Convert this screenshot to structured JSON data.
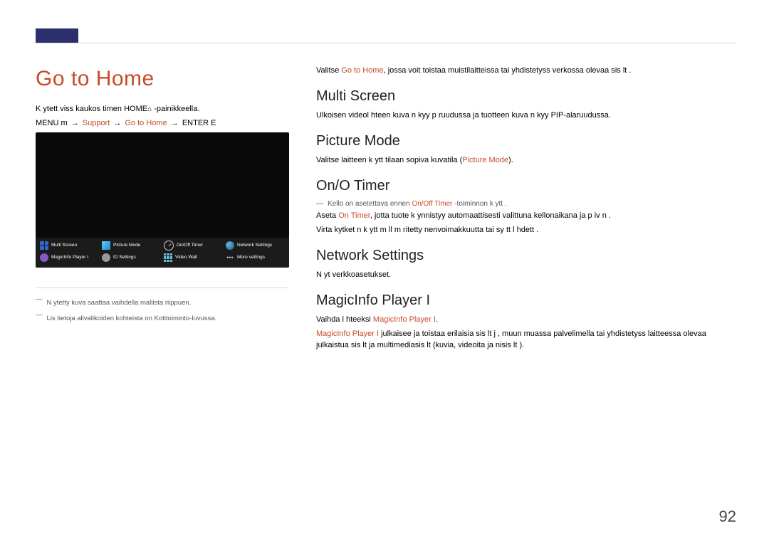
{
  "page_number": "92",
  "left": {
    "title": "Go to Home",
    "intro_a": "K ytett viss  kaukos  timen HOME",
    "intro_b": " -painikkeella.",
    "menu": {
      "menu_label": "MENU m",
      "support": "Support",
      "gotohome": "Go to Home",
      "enter": "ENTER E"
    },
    "screenshot_items": [
      {
        "label": "Multi Screen"
      },
      {
        "label": "Picture Mode"
      },
      {
        "label": "On/Off Timer"
      },
      {
        "label": "Network Settings"
      },
      {
        "label": "MagicInfo Player I"
      },
      {
        "label": "ID Settings"
      },
      {
        "label": "Video Wall"
      },
      {
        "label": "More settings"
      }
    ],
    "footnote1": "N ytetty kuva saattaa vaihdella mallista riippuen.",
    "footnote2": "Lis tietoja alivalikoiden kohteista on Kotitoiminto-luvussa."
  },
  "right": {
    "intro": {
      "pre": "Valitse ",
      "hi": "Go to Home",
      "post": ", jossa voit toistaa muistilaitteissa tai yhdistetyss  verkossa olevaa sis lt  ."
    },
    "multiscreen": {
      "title": "Multi Screen",
      "text": "Ulkoisen videol hteen kuva n kyy p  ruudussa ja tuotteen kuva n kyy PIP-alaruudussa."
    },
    "picturemode": {
      "title": "Picture Mode",
      "pre": "Valitse laitteen k ytt tilaan sopiva kuvatila (",
      "hi": "Picture Mode",
      "post": ")."
    },
    "onoff": {
      "title": "On/O  Timer",
      "note_pre": "Kello on asetettava ennen ",
      "note_hi": "On/Off Timer",
      "note_post": " -toiminnon k ytt  .",
      "line2_pre": "Aseta ",
      "line2_hi": "On Timer",
      "line2_post": ", jotta tuote k ynnistyy automaattisesti valittuna kellonaikana ja p iv n .",
      "line3": "Virta kytket  n k ytt m ll  m  ritetty    nenvoimakkuutta tai sy tt l hdett ."
    },
    "network": {
      "title": "Network Settings",
      "text": "N yt  verkkoasetukset."
    },
    "magicinfo": {
      "title": "MagicInfo Player I",
      "l1_pre": "Vaihda l hteeksi ",
      "l1_hi": "MagicInfo Player I",
      "l1_post": ".",
      "l2_hi": "MagicInfo Player I",
      "l2_post": " julkaisee ja toistaa erilaisia sis lt j , muun muassa palvelimella tai yhdistetyss  laitteessa olevaa julkaistua sis lt   ja multimediasis lt   (kuvia, videoita ja   nisis lt  )."
    }
  }
}
